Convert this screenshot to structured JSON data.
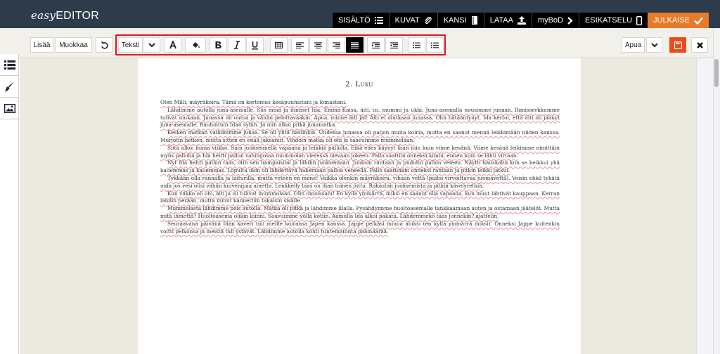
{
  "app": {
    "logo_prefix": "easy",
    "logo_suffix": "EDITOR"
  },
  "topnav": [
    {
      "label": "SISÄLTÖ",
      "icon": "list-icon"
    },
    {
      "label": "KUVAT",
      "icon": "attach-icon"
    },
    {
      "label": "KANSI",
      "icon": "book-icon"
    },
    {
      "label": "LATAA",
      "icon": "upload-icon"
    },
    {
      "label": "myBoD",
      "icon": "chevron-right-icon"
    },
    {
      "label": "ESIKATSELU",
      "icon": "phone-icon"
    },
    {
      "label": "JULKAISE",
      "icon": "check-icon"
    }
  ],
  "toolbar": {
    "add_label": "Lisää",
    "edit_label": "Muokkaa",
    "style_value": "Teksti",
    "help_value": "Apua",
    "colors": {
      "accent": "#e87b2a",
      "highlight": "#e0141e",
      "save": "#e84b1c"
    }
  },
  "rail": {
    "items": [
      "list-icon",
      "brush-icon",
      "image-icon"
    ]
  },
  "document": {
    "chapter_number": "2.",
    "chapter_title": "Luku",
    "paragraphs": [
      "Olen Milli, mäyräkoira. Tämä on kertomus kesäpuuhistani ja lomastani.",
      "Lähdimme autolla juna-asemalle. Siis minä ja ihmiset Ida, Emma-Kaisa, äiti, isi, mummi ja ukki. Juna-asemalla nousimme junaan. Ihmisserkkumme tulivat mukaan. Junassa oli outoa ja vähän pelottavaakin. Apua, minne äiti jäi! Äiti ei olutkaan junassa. Olin hätääntynyt. Ida kertoi, että äiti oli jäänyt juna-asemalle. Rauhoituin Idan syliin. Ja niin alkoi pitkä junamatka.",
      "Kesken matkan vaihdoimme junaa. Se oli yhtä häslinkiä. Uudessa junassa oli paljon muita koiria, mutta en saanut mennä leikkimään niiden kanssa. Murjotin hetken, mutta sitten en enää jaksanut. Vihdoin matka oli ohi ja saavuimme mummolaan.",
      "Siitä alkoi ihana viikko. Sain juoksennella vapaana ja leikkiä pallolla. Eikä edes käynyt ihan niin kuin viime kesänä. Viime kesänä leikimme nimittäin myös pallolla ja Ida heitti pallon vahingossa mummolan vieressä olevaan jokeen. Pallo saattiin onneksi kiinni, ennen kuin se lähti virtaan.",
      "Nyt Ida heitti pallon taas, otin sen hampaisiini ja lähdin juoksemaan. Juoksin rantaan ja pudotin pallon veteen. Näytti hauskalta kun se keikkui yhä kauemmas ja kauemmas. Lopulta ukin oli lähdettävä hakemaan palloa veneellä. Pallo saatiinkin onneksi rantaan ja pitkin leikki jatkui.",
      "Tykkään olla rannalla ja laiturilla, mutta veteen en mene! Vaikka olenkin mäyräkoira, vihaan vettä (paitsi virvoittavaa juomavettä). Voisin ehkä tykätä uida jos vesi olisi vähän kuivempaa ainetta. Lenkkeily taas on ihan toinen juttu. Rakastan juoksemista ja pitkiä kävelyretkiä.",
      "Kun viikko oli ohi, äiti ja isi tulivat mummolaan. Olin innoissani! En kyllä ymmärrä, miksi en saanut olla vapaana, kun muut lähtivät kauppaan. Kerran lähdin perään, mutta minut kannettiin takaisin sisälle.",
      "Mummolasta lähdimme pois autolla. Matka oli pitkä ja lähdimme illalla. Pysähdyimme huoltoasemalle tankkaamaan auton ja ostamaan jäätelöt. Mutta mitä ihmettä? Huoltoasema olikin kiinni. Saavuimme yöllä kotiin. Aamulla Ida alkoi pakata. Lähdemmekö taas jonnekin?,ajattelin.",
      "Seuraavana päivänä Idan kaveri tuli meille koiransa Japen kanssa. Jappe pelkäsi minua aluksi (en kyllä ymmärrä miksi). Onneksi Jappe kuitenkin voitti pelkonsa ja meistä tuli ystävät. Lähdimme autolla kohti tuntematonta päämäärää."
    ]
  }
}
